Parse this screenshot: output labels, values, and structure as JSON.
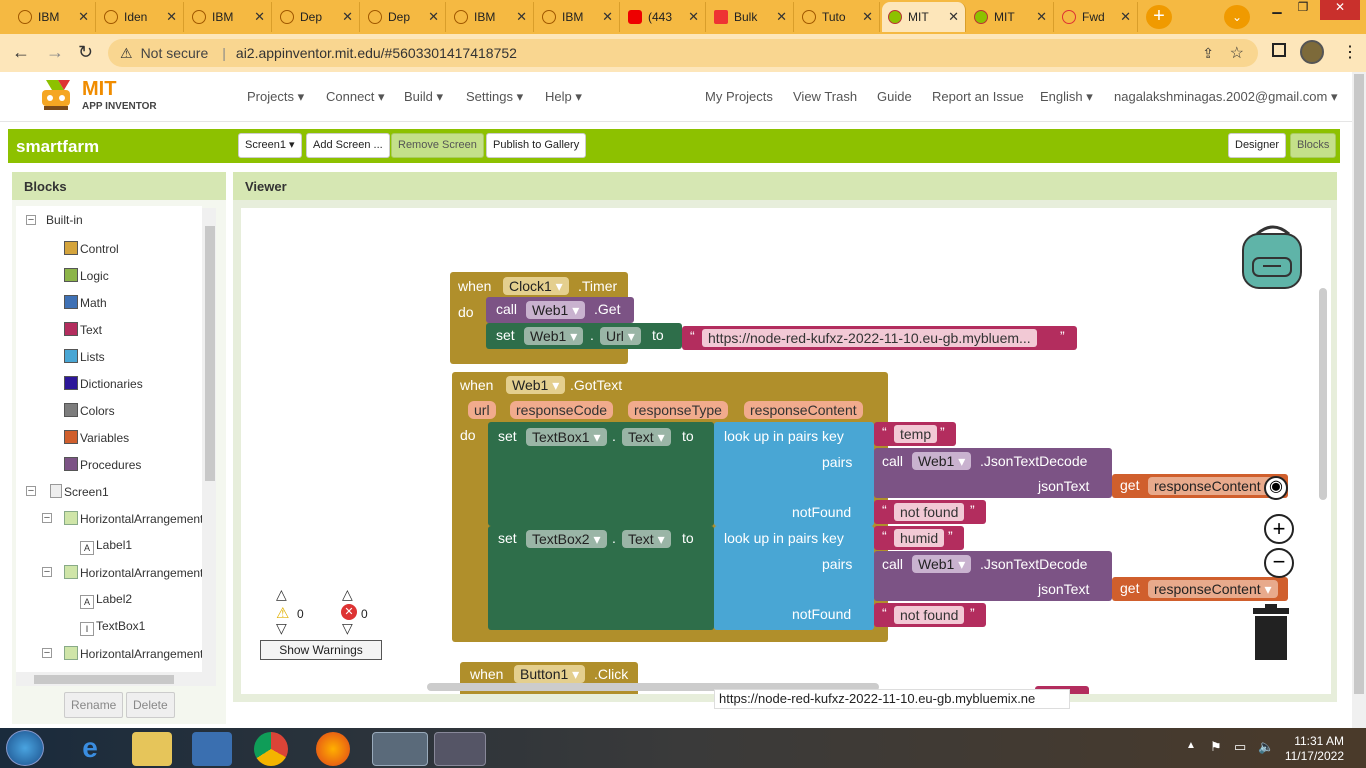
{
  "browser": {
    "tabs": [
      {
        "label": "IBM"
      },
      {
        "label": "Iden"
      },
      {
        "label": "IBM"
      },
      {
        "label": "Dep"
      },
      {
        "label": "Dep"
      },
      {
        "label": "IBM"
      },
      {
        "label": "IBM"
      },
      {
        "label": "(443"
      },
      {
        "label": "Bulk"
      },
      {
        "label": "Tuto"
      },
      {
        "label": "MIT"
      },
      {
        "label": "MIT"
      },
      {
        "label": "Fwd"
      }
    ],
    "not_secure": "Not secure",
    "url": "ai2.appinventor.mit.edu/#5603301417418752"
  },
  "app": {
    "logo_title": "MIT",
    "logo_subtitle": "APP INVENTOR",
    "menu": [
      "Projects ▾",
      "Connect ▾",
      "Build ▾",
      "Settings ▾",
      "Help ▾"
    ],
    "links": [
      "My Projects",
      "View Trash",
      "Guide",
      "Report an Issue",
      "English ▾",
      "nagalakshminagas.2002@gmail.com ▾"
    ]
  },
  "toolbar": {
    "project": "smartfarm",
    "screen": "Screen1 ▾",
    "add_screen": "Add Screen ...",
    "remove_screen": "Remove Screen",
    "publish": "Publish to Gallery",
    "designer": "Designer",
    "blocks": "Blocks"
  },
  "blocks_panel": {
    "title": "Blocks",
    "builtin": "Built-in",
    "builtins": [
      {
        "label": "Control",
        "color": "#d4a43c"
      },
      {
        "label": "Logic",
        "color": "#8cb449"
      },
      {
        "label": "Math",
        "color": "#3f71b5"
      },
      {
        "label": "Text",
        "color": "#b32d5e"
      },
      {
        "label": "Lists",
        "color": "#49a6d4"
      },
      {
        "label": "Dictionaries",
        "color": "#2d1799"
      },
      {
        "label": "Colors",
        "color": "#7d7d7d"
      },
      {
        "label": "Variables",
        "color": "#d05f2d"
      },
      {
        "label": "Procedures",
        "color": "#7c5385"
      }
    ],
    "components": [
      "Screen1",
      "HorizontalArrangement",
      "Label1",
      "HorizontalArrangement",
      "Label2",
      "TextBox1",
      "HorizontalArrangement"
    ],
    "rename": "Rename",
    "delete": "Delete"
  },
  "viewer": {
    "title": "Viewer",
    "warnings_count": "0",
    "errors_count": "0",
    "show_warnings": "Show Warnings",
    "status_url": "https://node-red-kufxz-2022-11-10.eu-gb.mybluemix.ne"
  },
  "code": {
    "b1": {
      "when": "when",
      "comp": "Clock1",
      "event": ".Timer",
      "do": "do",
      "call": "call",
      "web": "Web1",
      "get": ".Get",
      "set": "set",
      "prop": "Url",
      "dot": ".",
      "to": "to",
      "url": "https://node-red-kufxz-2022-11-10.eu-gb.mybluem..."
    },
    "b2": {
      "when": "when",
      "comp": "Web1",
      "event": ".GotText",
      "params": [
        "url",
        "responseCode",
        "responseType",
        "responseContent"
      ],
      "do": "do",
      "rows": [
        {
          "set": "set",
          "comp": "TextBox1",
          "dot": ".",
          "prop": "Text",
          "to": "to",
          "lookup": "look up in pairs  key",
          "key": "temp",
          "pairs": "pairs",
          "call": "call",
          "web": "Web1",
          "decode": ".JsonTextDecode",
          "jsontext": "jsonText",
          "get": "get",
          "var": "responseContent",
          "notfound": "notFound",
          "nf": "not found"
        },
        {
          "set": "set",
          "comp": "TextBox2",
          "dot": ".",
          "prop": "Text",
          "to": "to",
          "lookup": "look up in pairs  key",
          "key": "humid",
          "pairs": "pairs",
          "call": "call",
          "web": "Web1",
          "decode": ".JsonTextDecode",
          "jsontext": "jsonText",
          "get": "get",
          "var": "responseContent",
          "notfound": "notFound",
          "nf": "not found"
        }
      ]
    },
    "b3": {
      "when": "when",
      "comp": "Button1",
      "event": ".Click"
    }
  },
  "system": {
    "time": "11:31 AM",
    "date": "11/17/2022"
  }
}
